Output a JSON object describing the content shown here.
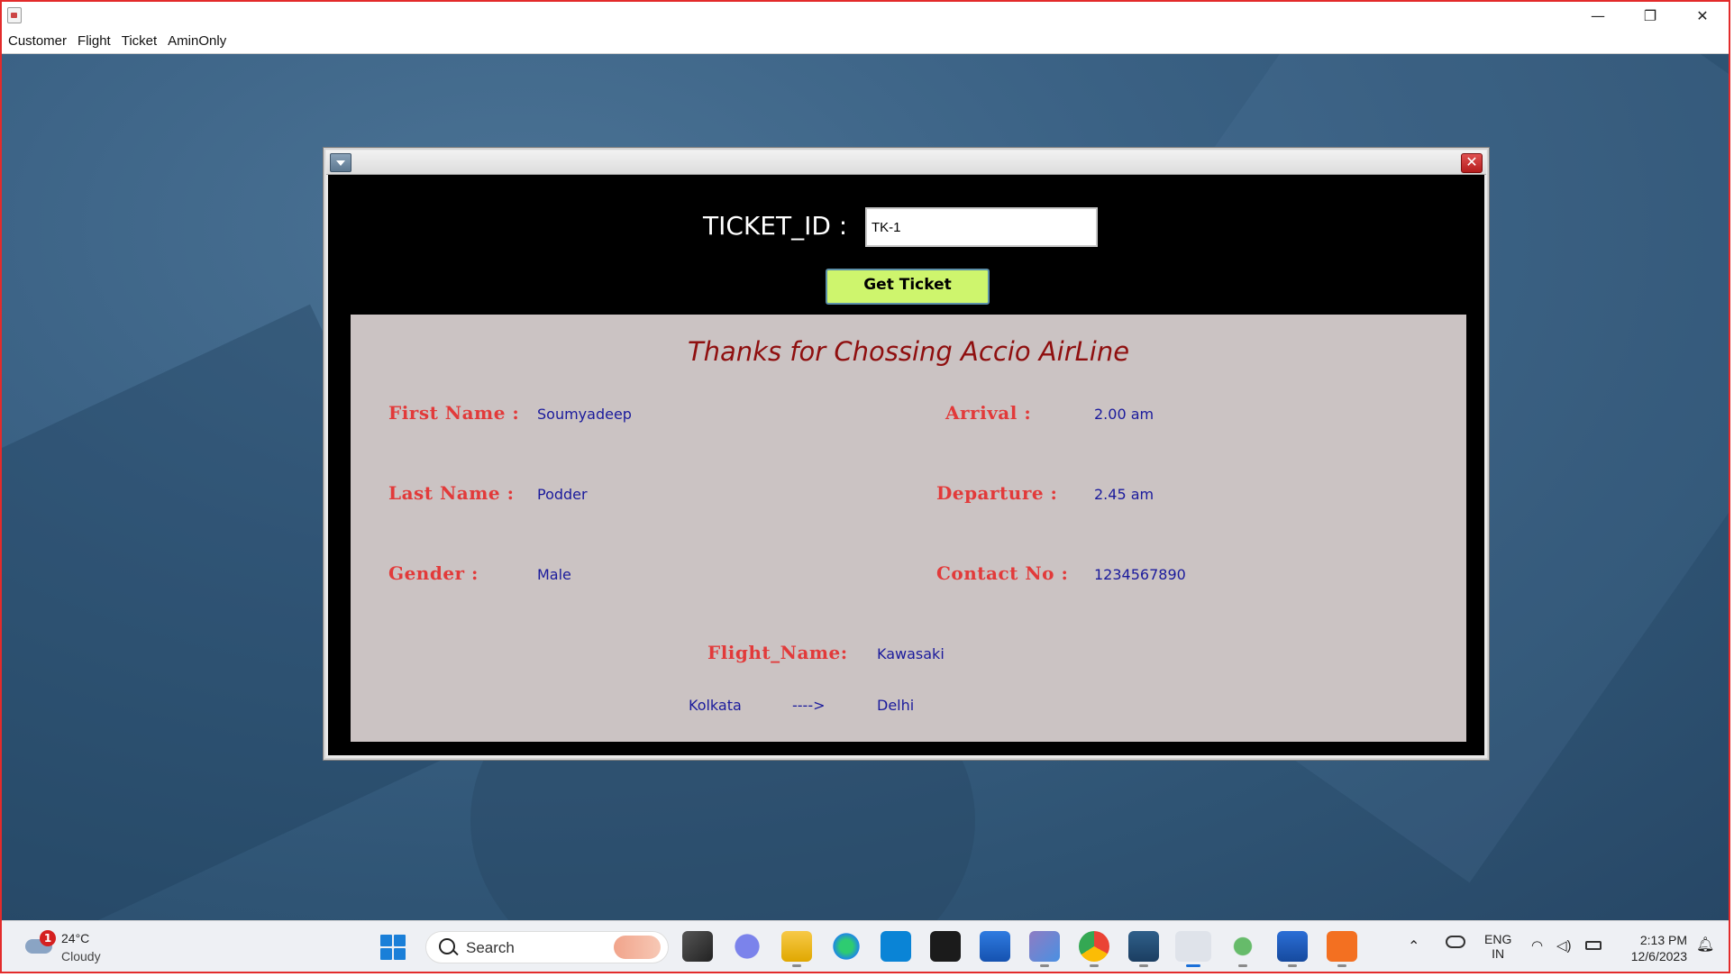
{
  "window": {
    "minimize": "—",
    "restore": "❐",
    "close": "✕"
  },
  "menu": [
    "Customer",
    "Flight",
    "Ticket",
    "AminOnly"
  ],
  "form": {
    "ticket_label": "TICKET_ID :",
    "ticket_value": "TK-1",
    "button": "Get Ticket",
    "close_glyph": "✕"
  },
  "ticket": {
    "thanks": "Thanks for Chossing Accio AirLine",
    "first_name_label": "First Name :",
    "first_name": "Soumyadeep",
    "last_name_label": "Last Name :",
    "last_name": "Podder",
    "gender_label": "Gender :",
    "gender": "Male",
    "arrival_label": "Arrival :",
    "arrival": "2.00 am",
    "departure_label": "Departure :",
    "departure": "2.45 am",
    "contact_label": "Contact No :",
    "contact": "1234567890",
    "flight_label": "Flight_Name:",
    "flight": "Kawasaki",
    "from": "Kolkata",
    "arrow": "---->",
    "to": "Delhi"
  },
  "taskbar": {
    "weather_badge": "1",
    "temperature": "24°C",
    "condition": "Cloudy",
    "search": "Search",
    "lang": "ENG",
    "region": "IN",
    "time": "2:13 PM",
    "date": "12/6/2023",
    "icons": [
      "task-view-icon",
      "chat-icon",
      "file-explorer-icon",
      "edge-icon",
      "cortana-icon",
      "terminal-icon",
      "store-icon",
      "cube-app-icon",
      "chrome-icon",
      "mysql-icon",
      "java-icon",
      "atom-icon",
      "word-icon",
      "xampp-icon"
    ]
  }
}
